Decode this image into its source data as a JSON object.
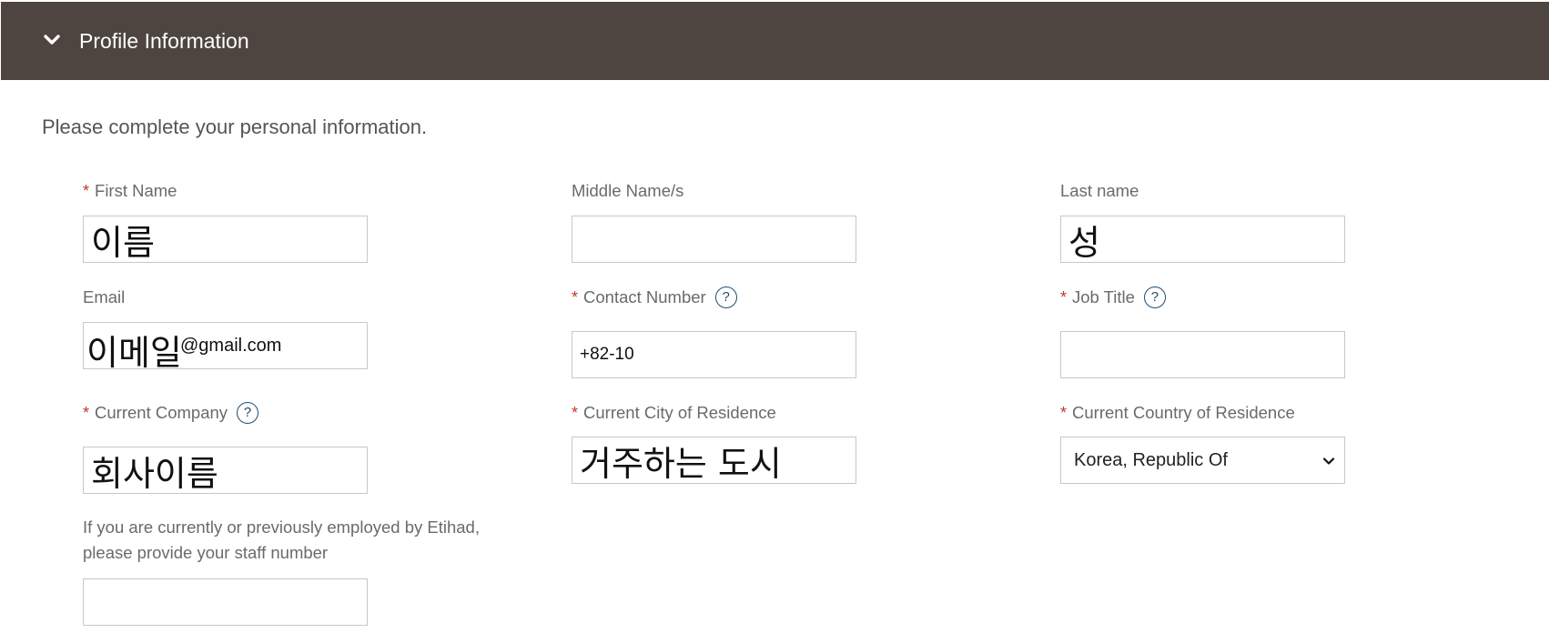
{
  "section": {
    "title": "Profile Information",
    "intro": "Please complete your personal information."
  },
  "fields": {
    "first_name": {
      "label": "First Name",
      "required_marker": "*",
      "value": "이름",
      "placeholder": ""
    },
    "middle_name": {
      "label": "Middle Name/s",
      "value": "",
      "placeholder": ""
    },
    "last_name": {
      "label": "Last name",
      "value": "성",
      "placeholder": ""
    },
    "email": {
      "label": "Email",
      "value_korean": "이메일",
      "value_suffix": "@gmail.com"
    },
    "contact_number": {
      "label": "Contact Number",
      "required_marker": "*",
      "value": "+82-10",
      "help": "?"
    },
    "job_title": {
      "label": "Job Title",
      "required_marker": "*",
      "value": "",
      "help": "?"
    },
    "current_company": {
      "label": "Current Company",
      "required_marker": "*",
      "value": "회사이름",
      "help": "?"
    },
    "current_city": {
      "label": "Current City of Residence",
      "required_marker": "*",
      "value": "거주하는 도시"
    },
    "current_country": {
      "label": "Current Country of Residence",
      "required_marker": "*",
      "selected": "Korea, Republic Of"
    },
    "staff_number": {
      "label_line1": "If you are currently or previously employed by Etihad,",
      "label_line2": "please provide your staff number",
      "value": ""
    }
  },
  "icons": {
    "section_toggle": "chevron-down-icon",
    "help": "question-circle-icon",
    "select_arrow": "chevron-down-icon"
  },
  "colors": {
    "header_bg": "#4e4540",
    "required": "#c0392b",
    "help_icon": "#1d4f74"
  }
}
